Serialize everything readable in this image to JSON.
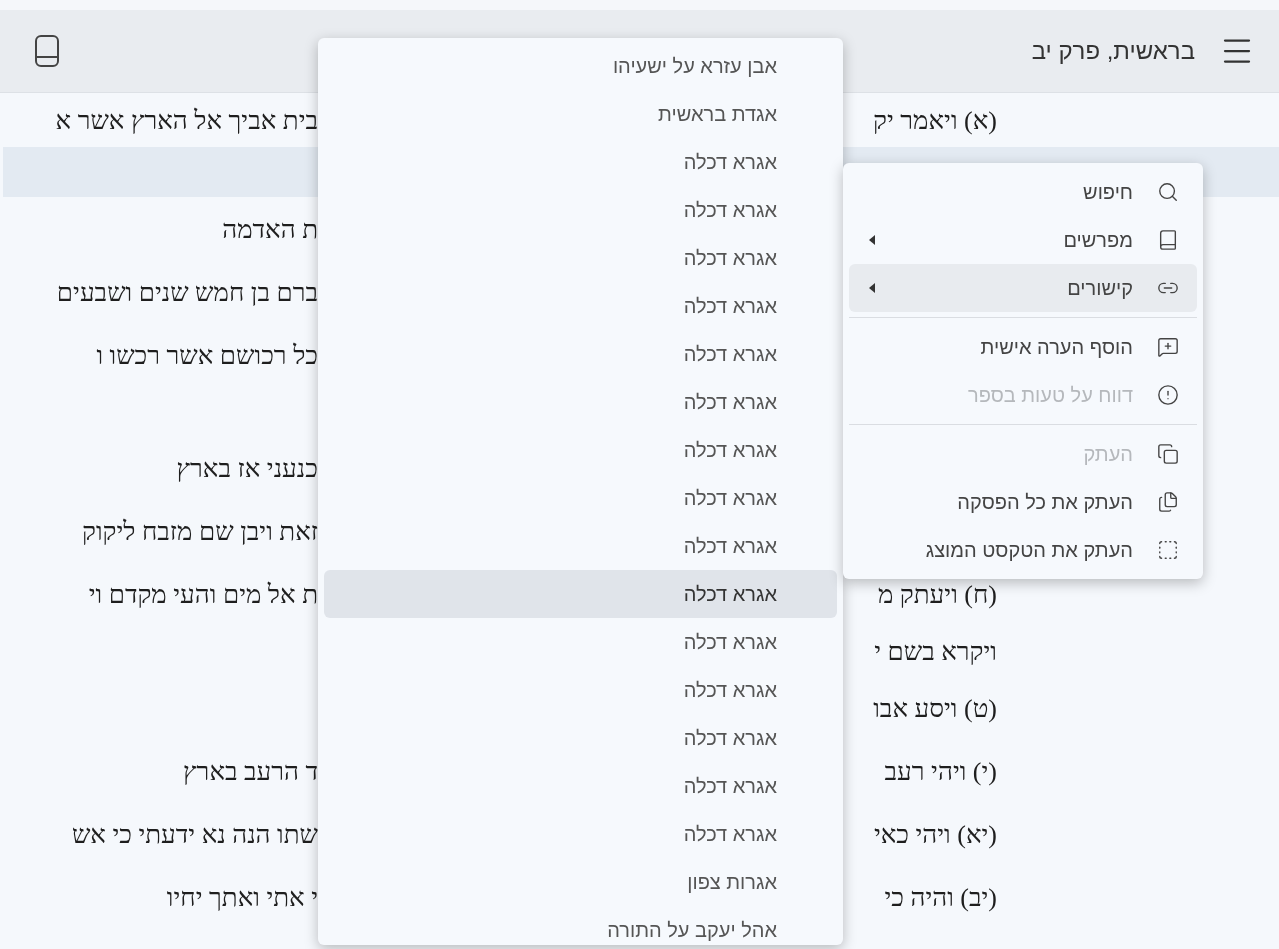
{
  "header": {
    "title": "בראשית, פרק יב"
  },
  "verses": [
    {
      "kind": "verse",
      "selected": false,
      "start": "(א) ויאמר יק",
      "end": "בית אביך אל הארץ אשר א"
    },
    {
      "kind": "covered",
      "selected": true
    },
    {
      "kind": "verse",
      "selected": false,
      "end": "ת האדמה"
    },
    {
      "kind": "verse",
      "selected": false,
      "end": "ברם בן חמש שנים ושבעים"
    },
    {
      "kind": "verse",
      "selected": false,
      "end": "כל רכושם אשר רכשו ו"
    },
    {
      "kind": "covered",
      "selected": false
    },
    {
      "kind": "verse",
      "selected": false,
      "end": "כנעני אז בארץ"
    },
    {
      "kind": "verse",
      "selected": false,
      "end": "זאת ויבן שם מזבח ליקוק"
    },
    {
      "kind": "verse",
      "selected": false,
      "start": "(ח) ויעתק מ",
      "end": "ת אל מים והעי מקדם וי"
    },
    {
      "kind": "wrap",
      "selected": false,
      "start": "ויקרא בשם י"
    },
    {
      "kind": "verse",
      "selected": false,
      "start": "(ט) ויסע אבו"
    },
    {
      "kind": "verse",
      "selected": false,
      "start": "(י) ויהי רעב",
      "end": "ד הרעב בארץ"
    },
    {
      "kind": "verse",
      "selected": false,
      "start": "(יא) ויהי כאי",
      "end": "שתו הנה נא ידעתי כי אש"
    },
    {
      "kind": "verse",
      "selected": false,
      "start": "(יב) והיה כי",
      "end": "י אתי ואתך יחיו"
    }
  ],
  "links_submenu": [
    {
      "label": "אבן עזרא על ישעיהו",
      "highlighted": false
    },
    {
      "label": "אגדת בראשית",
      "highlighted": false
    },
    {
      "label": "אגרא דכלה",
      "highlighted": false
    },
    {
      "label": "אגרא דכלה",
      "highlighted": false
    },
    {
      "label": "אגרא דכלה",
      "highlighted": false
    },
    {
      "label": "אגרא דכלה",
      "highlighted": false
    },
    {
      "label": "אגרא דכלה",
      "highlighted": false
    },
    {
      "label": "אגרא דכלה",
      "highlighted": false
    },
    {
      "label": "אגרא דכלה",
      "highlighted": false
    },
    {
      "label": "אגרא דכלה",
      "highlighted": false
    },
    {
      "label": "אגרא דכלה",
      "highlighted": false
    },
    {
      "label": "אגרא דכלה",
      "highlighted": true
    },
    {
      "label": "אגרא דכלה",
      "highlighted": false
    },
    {
      "label": "אגרא דכלה",
      "highlighted": false
    },
    {
      "label": "אגרא דכלה",
      "highlighted": false
    },
    {
      "label": "אגרא דכלה",
      "highlighted": false
    },
    {
      "label": "אגרא דכלה",
      "highlighted": false
    },
    {
      "label": "אגרות צפון",
      "highlighted": false
    },
    {
      "label": "אהל יעקב על התורה",
      "highlighted": false
    }
  ],
  "context_menu": [
    {
      "kind": "item",
      "label": "חיפוש",
      "submenu": false,
      "highlighted": false,
      "disabled": false
    },
    {
      "kind": "item",
      "label": "מפרשים",
      "submenu": true,
      "highlighted": false,
      "disabled": false
    },
    {
      "kind": "item",
      "label": "קישורים",
      "submenu": true,
      "highlighted": true,
      "disabled": false
    },
    {
      "kind": "divider"
    },
    {
      "kind": "item",
      "label": "הוסף הערה אישית",
      "submenu": false,
      "highlighted": false,
      "disabled": false
    },
    {
      "kind": "item",
      "label": "דווח על טעות בספר",
      "submenu": false,
      "highlighted": false,
      "disabled": true
    },
    {
      "kind": "divider"
    },
    {
      "kind": "item",
      "label": "העתק",
      "submenu": false,
      "highlighted": false,
      "disabled": true
    },
    {
      "kind": "item",
      "label": "העתק את כל הפסקה",
      "submenu": false,
      "highlighted": false,
      "disabled": false
    },
    {
      "kind": "item",
      "label": "העתק את הטקסט המוצג",
      "submenu": false,
      "highlighted": false,
      "disabled": false
    }
  ]
}
